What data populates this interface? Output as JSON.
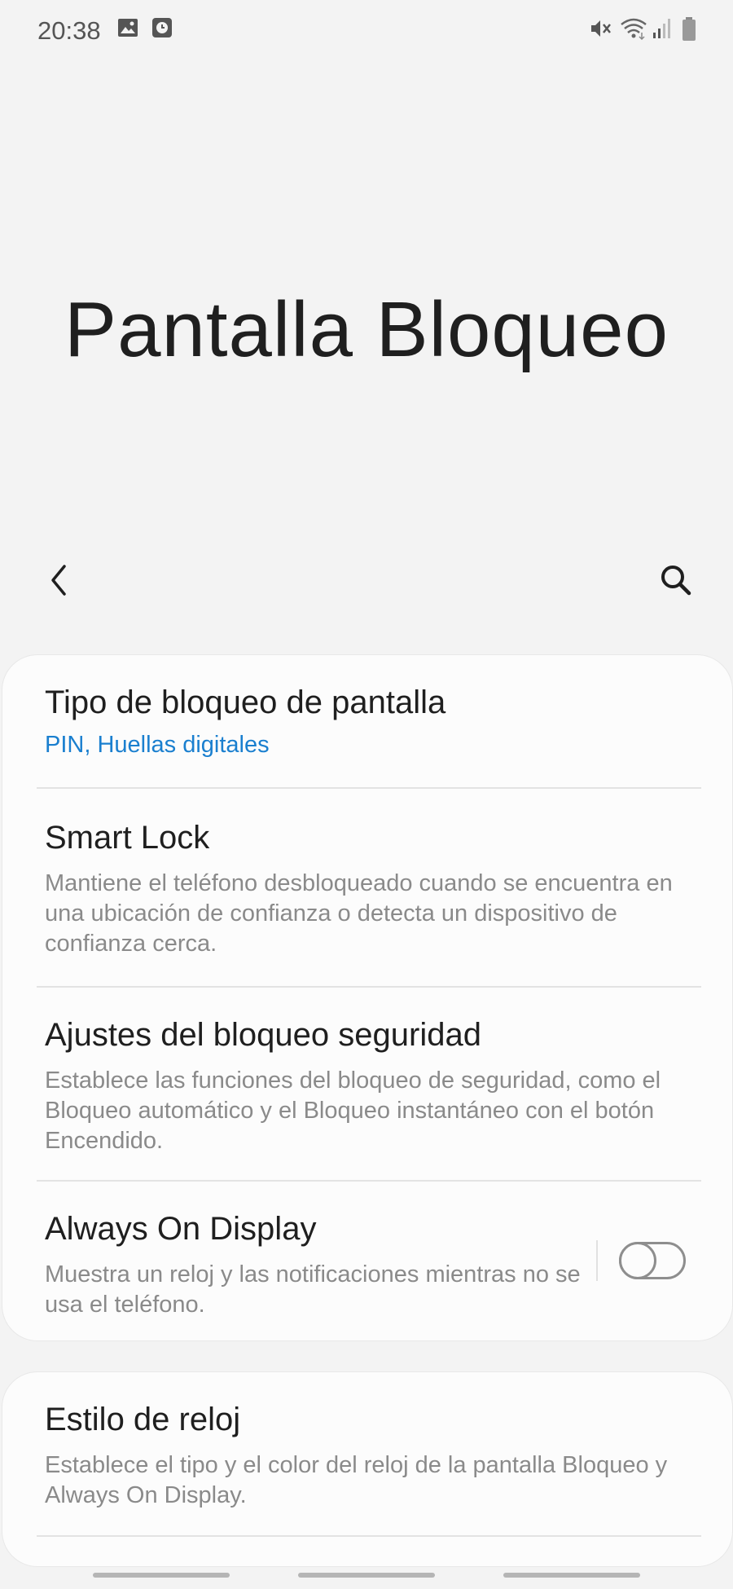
{
  "status_bar": {
    "time": "20:38",
    "icons": [
      "gallery-icon",
      "clock-app-icon",
      "mute-icon",
      "wifi-icon",
      "signal-icon",
      "battery-icon"
    ]
  },
  "header": {
    "title": "Pantalla Bloqueo",
    "back_icon": "chevron-left-icon",
    "search_icon": "search-icon"
  },
  "settings": {
    "items": [
      {
        "title": "Tipo de bloqueo de pantalla",
        "subtitle": "PIN, Huellas digitales"
      },
      {
        "title": "Smart Lock",
        "subtitle": "Mantiene el teléfono desbloqueado cuando se encuentra en una ubicación de confianza o detecta un dispositivo de confianza cerca."
      },
      {
        "title": "Ajustes del bloqueo seguridad",
        "subtitle": "Establece las funciones del bloqueo de seguridad, como el Bloqueo automático y el Bloqueo instantáneo con el botón Encendido."
      },
      {
        "title": "Always On Display",
        "subtitle": "Muestra un reloj y las notificaciones mientras no se usa el teléfono.",
        "toggle_on": false
      },
      {
        "title": "Estilo de reloj",
        "subtitle": "Establece el tipo y el color del reloj de la pantalla Bloqueo y Always On Display."
      }
    ]
  },
  "colors": {
    "background": "#f3f3f3",
    "card": "#fcfcfc",
    "accent": "#1a7fcf",
    "secondary_text": "#8a8a8a"
  }
}
